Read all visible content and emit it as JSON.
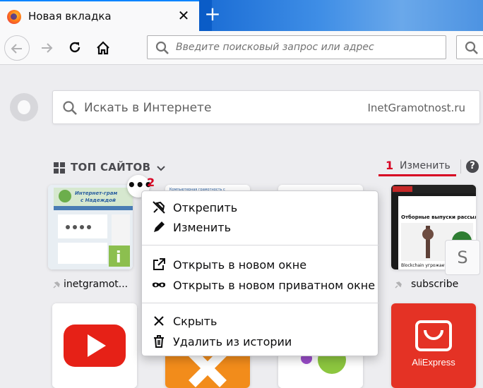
{
  "browser": {
    "tab_title": "Новая вкладка",
    "tab_close": "✕",
    "new_tab": "+",
    "urlbar_placeholder": "Введите поисковый запрос или адрес"
  },
  "newtab": {
    "web_search_placeholder": "Искать в Интернете",
    "web_search_engine": "InetGramotnost.ru",
    "topsites_label": "ТОП САЙТОВ",
    "edit_label": "Изменить",
    "help": "?",
    "annotation_1": "1",
    "annotation_2": "2"
  },
  "tiles": [
    {
      "label": "inetgramot...",
      "pinned": true
    },
    {
      "label": "",
      "pinned": false
    },
    {
      "label": "",
      "pinned": false
    },
    {
      "label": "subscribe",
      "pinned": true,
      "badge": "S"
    },
    {
      "label": "",
      "pinned": false
    },
    {
      "label": "",
      "pinned": false
    },
    {
      "label": "",
      "pinned": false
    },
    {
      "label": "",
      "pinned": false,
      "brand": "AliExpress"
    }
  ],
  "context_menu": {
    "unpin": "Открепить",
    "edit": "Изменить",
    "open_new_window": "Открыть в новом окне",
    "open_private_window": "Открыть в новом приватном окне",
    "dismiss": "Скрыть",
    "delete_history": "Удалить из истории"
  },
  "thumbnails": {
    "site1_header": "Интернет-грамотность с Надеждой",
    "site2_header": "Компьютерная грамотность с",
    "site4_header": "Отборные выпуски рассылок",
    "site4_caption": "Blockchain угрожает! Бьём"
  },
  "colors": {
    "accent": "#0a84ff",
    "annotation_red": "#d70022",
    "youtube_red": "#e62117",
    "aliexpress_red": "#e43225"
  }
}
